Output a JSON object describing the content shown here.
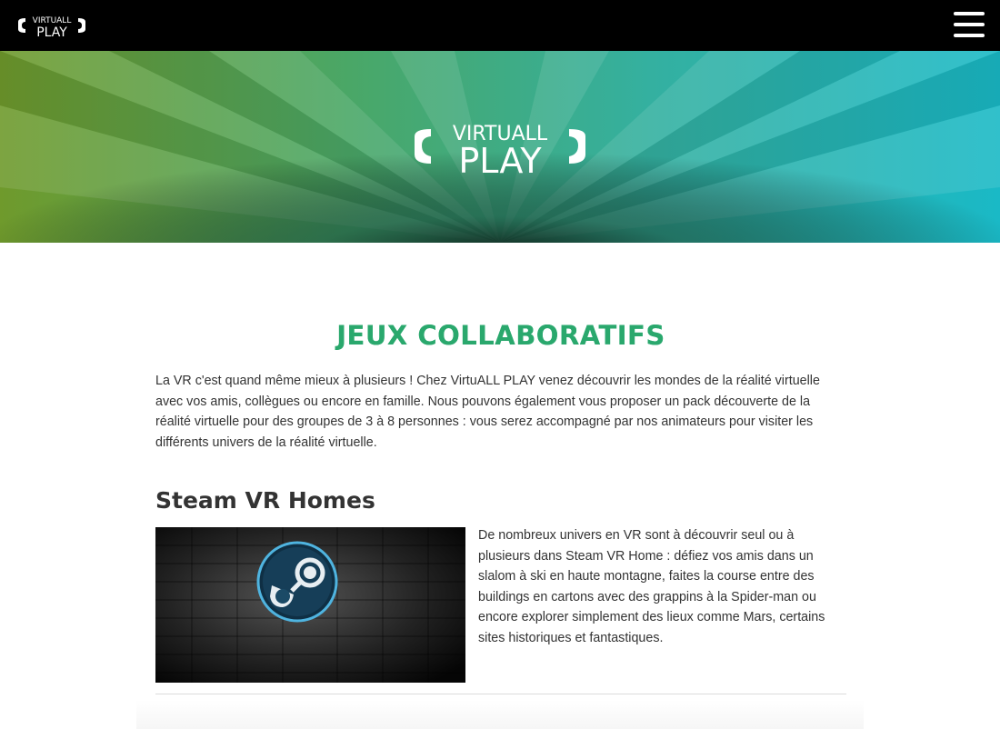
{
  "header": {
    "logo_line1": "VIRTUALL",
    "logo_line2": "PLAY",
    "menu_icon": "hamburger-icon"
  },
  "hero": {
    "logo_line1": "VIRTUALL",
    "logo_line2": "PLAY",
    "colors": [
      "#6f9a2c",
      "#4aa767",
      "#1ab9c6"
    ]
  },
  "main": {
    "section_title": "JEUX COLLABORATIFS",
    "intro": "La VR c'est quand même mieux à plusieurs ! Chez VirtuALL PLAY venez découvrir les mondes de la réalité virtuelle avec vos amis, collègues ou encore en famille. Nous pouvons également vous proposer un pack découverte de la réalité virtuelle pour des groupes de 3 à 8 personnes : vous serez accompagné par nos animateurs pour visiter les différents univers de la réalité virtuelle.",
    "games": [
      {
        "title": "Steam VR Homes",
        "image_icon": "steam-logo-icon",
        "description": "De nombreux univers en VR sont à découvrir seul ou à plusieurs dans Steam VR Home : défiez vos amis dans un slalom à ski en haute montagne, faites la course entre des buildings en cartons avec des grappins à la Spider-man ou encore explorer simplement des lieux comme Mars, certains sites historiques et fantastiques."
      }
    ]
  }
}
